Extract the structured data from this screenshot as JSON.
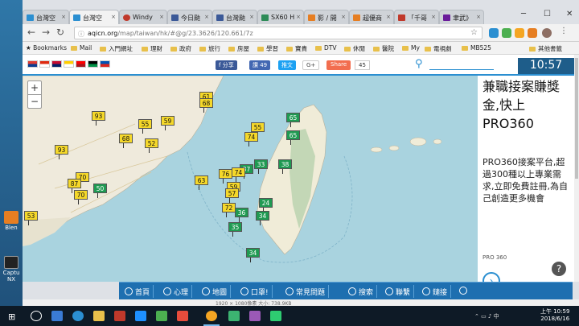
{
  "desktop": {
    "icons": [
      {
        "label": "Blen"
      },
      {
        "label": "Captu NX"
      }
    ]
  },
  "browser": {
    "tabs": [
      {
        "label": "台灣空",
        "active": false,
        "color": "#2b8fd1"
      },
      {
        "label": "台灣空",
        "active": true,
        "color": "#2b8fd1"
      },
      {
        "label": "Windy",
        "active": false,
        "color": "#c0392b"
      },
      {
        "label": "今日颱",
        "active": false,
        "color": "#3b5998"
      },
      {
        "label": "台灣颱",
        "active": false,
        "color": "#3b5998"
      },
      {
        "label": "SX60 H",
        "active": false,
        "color": "#2e8b57"
      },
      {
        "label": "影 / 開",
        "active": false,
        "color": "#e67e22"
      },
      {
        "label": "超優商",
        "active": false,
        "color": "#e67e22"
      },
      {
        "label": "「千哥",
        "active": false,
        "color": "#c0392b"
      },
      {
        "label": "聿武》",
        "active": false,
        "color": "#6a1b9a"
      }
    ],
    "window_controls": {
      "minimize": "─",
      "maximize": "☐",
      "close": "✕"
    },
    "nav": {
      "back": "←",
      "forward": "→",
      "reload": "↻"
    },
    "url_host": "aqicn.org",
    "url_path": "/map/taiwan/hk/#@g/23.3626/120.661/7z",
    "bookmarks": [
      "Bookmarks",
      "Mail",
      "入門網址",
      "理財",
      "政府",
      "旅行",
      "房屋",
      "學習",
      "寶貴",
      "DTV",
      "休閒",
      "醫院",
      "My",
      "電視劇",
      "MB525"
    ],
    "other_bookmarks": "其他書籤"
  },
  "site": {
    "fb_share": "f 分享",
    "fb_like": "讚 49",
    "tweet": "推文",
    "gplus": "G+",
    "share_button": "Share",
    "share_count": "45",
    "clock": "10:57",
    "flag_colors": [
      "#e03c31",
      "#0b3d91",
      "#de2910",
      "#ffffff",
      "#c60c30",
      "#012169",
      "#ffce00",
      "#ffffff",
      "#fe0000",
      "#aa151b",
      "#000000",
      "#009246",
      "#0052b4",
      "#da251d"
    ]
  },
  "map": {
    "zoom_in": "+",
    "zoom_out": "−",
    "markers": [
      {
        "value": "61",
        "c": "y"
      },
      {
        "value": "68",
        "c": "y"
      },
      {
        "value": "93",
        "c": "y"
      },
      {
        "value": "55",
        "c": "y"
      },
      {
        "value": "59",
        "c": "y"
      },
      {
        "value": "93",
        "c": "y"
      },
      {
        "value": "68",
        "c": "y"
      },
      {
        "value": "52",
        "c": "y"
      },
      {
        "value": "70",
        "c": "y"
      },
      {
        "value": "87",
        "c": "y"
      },
      {
        "value": "50",
        "c": "g"
      },
      {
        "value": "70",
        "c": "y"
      },
      {
        "value": "53",
        "c": "y"
      },
      {
        "value": "65",
        "c": "g"
      },
      {
        "value": "65",
        "c": "g"
      },
      {
        "value": "55",
        "c": "y"
      },
      {
        "value": "74",
        "c": "y"
      },
      {
        "value": "38",
        "c": "g"
      },
      {
        "value": "33",
        "c": "g"
      },
      {
        "value": "37",
        "c": "g"
      },
      {
        "value": "63",
        "c": "y"
      },
      {
        "value": "76",
        "c": "y"
      },
      {
        "value": "74",
        "c": "y"
      },
      {
        "value": "59",
        "c": "y"
      },
      {
        "value": "57",
        "c": "y"
      },
      {
        "value": "72",
        "c": "y"
      },
      {
        "value": "24",
        "c": "g"
      },
      {
        "value": "36",
        "c": "g"
      },
      {
        "value": "34",
        "c": "g"
      },
      {
        "value": "35",
        "c": "g"
      },
      {
        "value": "34",
        "c": "g"
      }
    ]
  },
  "ad": {
    "headline": "兼職接案賺獎金,快上PRO360",
    "body": "PRO360接案平台,超過300種以上專業需求,立即免費註冊,為自己創造更多機會",
    "brand": "PRO 360",
    "help": "?",
    "arrow": "›"
  },
  "sitenav": {
    "items": [
      "首頁",
      "心理",
      "地圖",
      "口罩!",
      "常見問題",
      "搜索",
      "聯繫",
      "鏈接",
      ""
    ]
  },
  "status": "1920 × 1080像素   大小: 738.9KB",
  "taskbar": {
    "time": "上午 10:59",
    "date": "2018/6/16",
    "icon_colors": [
      "#ffffff",
      "#3a7bd5",
      "#2b8fd1",
      "#e8c04b",
      "#c0392b",
      "#1e90ff",
      "#4caf50",
      "#f5a623",
      "#3cb371",
      "#9b59b6",
      "#e74c3c"
    ]
  }
}
